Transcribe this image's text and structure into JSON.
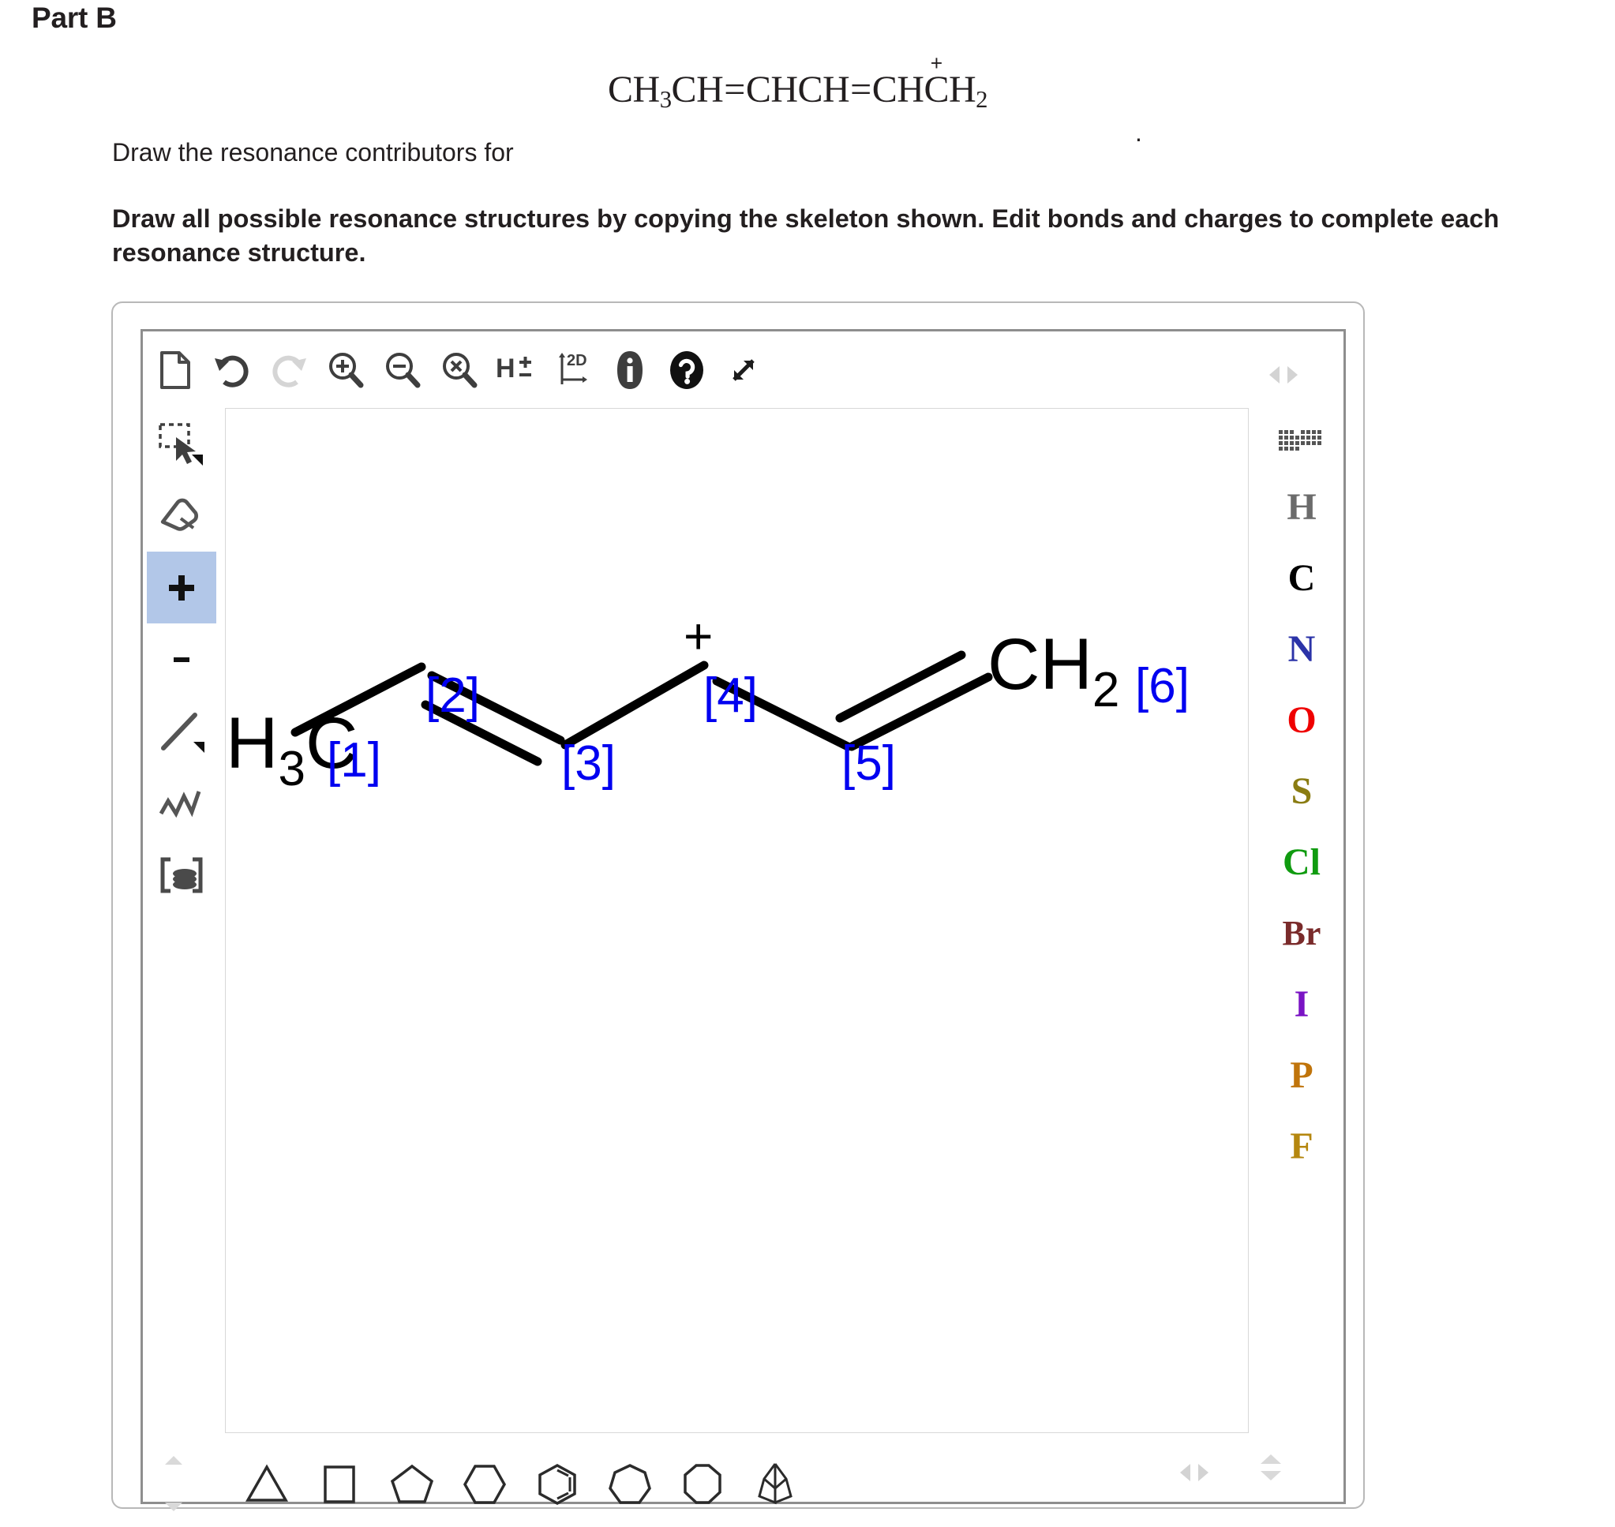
{
  "page": {
    "part_title": "Part B",
    "prompt_lead": "Draw the resonance contributors for",
    "prompt_period": ".",
    "instruction": "Draw all possible resonance structures by copying the skeleton shown. Edit bonds and charges to complete each resonance structure.",
    "formula": {
      "segments": [
        "CH",
        "3",
        "CH",
        "=",
        "CHCH",
        "=",
        "CHCH",
        "2"
      ],
      "plain": "CH3CH=CHCH=CHCH2+",
      "charge": "+"
    }
  },
  "editor": {
    "top_toolbar": [
      {
        "name": "new-document",
        "label": "New"
      },
      {
        "name": "undo",
        "label": "Undo"
      },
      {
        "name": "redo",
        "label": "Redo",
        "disabled": true
      },
      {
        "name": "zoom-in",
        "label": "Zoom In"
      },
      {
        "name": "zoom-out",
        "label": "Zoom Out"
      },
      {
        "name": "zoom-reset",
        "label": "Reset Zoom"
      },
      {
        "name": "hydrogen-toggle",
        "label": "H±"
      },
      {
        "name": "clean-2d",
        "label": "2D"
      },
      {
        "name": "info",
        "label": "Info"
      },
      {
        "name": "help",
        "label": "Help"
      },
      {
        "name": "fullscreen",
        "label": "Expand"
      }
    ],
    "left_tools": [
      {
        "name": "select-lasso",
        "label": "Select",
        "active": false
      },
      {
        "name": "eraser",
        "label": "Erase",
        "active": false
      },
      {
        "name": "increase-charge",
        "label": "+",
        "active": true
      },
      {
        "name": "decrease-charge",
        "label": "-",
        "active": false
      },
      {
        "name": "single-bond",
        "label": "Single Bond",
        "active": false
      },
      {
        "name": "chain",
        "label": "Chain",
        "active": false
      },
      {
        "name": "template-group",
        "label": "Templates",
        "active": false
      }
    ],
    "elements": [
      {
        "symbol": "H",
        "color": "#6b6b6b"
      },
      {
        "symbol": "C",
        "color": "#000000"
      },
      {
        "symbol": "N",
        "color": "#2b33a8"
      },
      {
        "symbol": "O",
        "color": "#ef0000"
      },
      {
        "symbol": "S",
        "color": "#8a7c12"
      },
      {
        "symbol": "Cl",
        "color": "#109b10"
      },
      {
        "symbol": "Br",
        "color": "#7a2b2b"
      },
      {
        "symbol": "I",
        "color": "#7a13c4"
      },
      {
        "symbol": "P",
        "color": "#c0740b"
      },
      {
        "symbol": "F",
        "color": "#b5870f"
      }
    ],
    "periodic_table_icon": "periodic-table-icon",
    "rings": [
      {
        "name": "cyclopropane",
        "sides": 3
      },
      {
        "name": "cyclobutane",
        "sides": 4
      },
      {
        "name": "cyclopentane",
        "sides": 5
      },
      {
        "name": "cyclohexane",
        "sides": 6
      },
      {
        "name": "benzene",
        "sides": 6
      },
      {
        "name": "cycloheptane",
        "sides": 7
      },
      {
        "name": "cyclooctane",
        "sides": 8
      },
      {
        "name": "bicyclic",
        "sides": 0
      }
    ],
    "canvas": {
      "skeleton_labels": [
        "[1]",
        "[2]",
        "[3]",
        "[4]",
        "[5]",
        "[6]"
      ],
      "label_color": "#0000f0",
      "terminal_left": "H3C",
      "terminal_left_sub": "3",
      "terminal_right": "CH2",
      "terminal_right_sub": "2",
      "charge_marker": "+",
      "bonds": [
        {
          "from": 1,
          "to": 2,
          "order": 1
        },
        {
          "from": 2,
          "to": 3,
          "order": 2
        },
        {
          "from": 3,
          "to": 4,
          "order": 1
        },
        {
          "from": 4,
          "to": 5,
          "order": 1
        },
        {
          "from": 5,
          "to": 6,
          "order": 2
        }
      ],
      "charges": [
        {
          "atom": 4,
          "sign": "+"
        }
      ]
    }
  }
}
